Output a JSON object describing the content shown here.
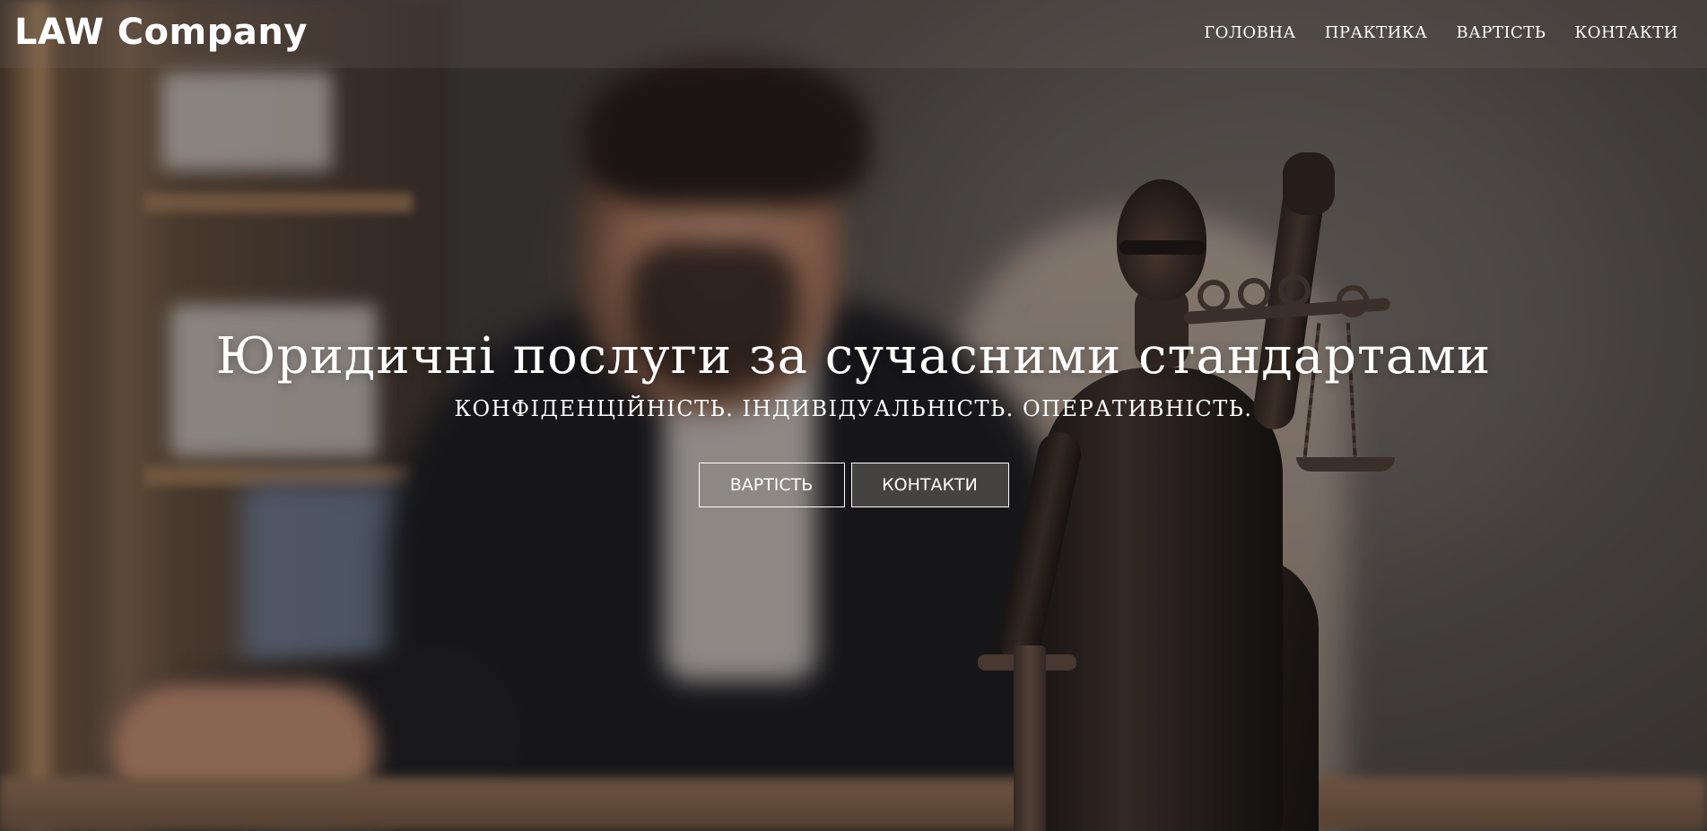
{
  "header": {
    "logo": "LAW Company",
    "nav": [
      {
        "label": "ГОЛОВНА"
      },
      {
        "label": "ПРАКТИКА"
      },
      {
        "label": "ВАРТІСТЬ"
      },
      {
        "label": "КОНТАКТИ"
      }
    ]
  },
  "hero": {
    "title": "Юридичні послуги за сучасними стандартами",
    "subtitle": "КОНФІДЕНЦІЙНІСТЬ. ІНДИВІДУАЛЬНІСТЬ. ОПЕРАТИВНІСТЬ.",
    "buttons": {
      "pricing": "ВАРТІСТЬ",
      "contacts": "КОНТАКТИ"
    }
  }
}
